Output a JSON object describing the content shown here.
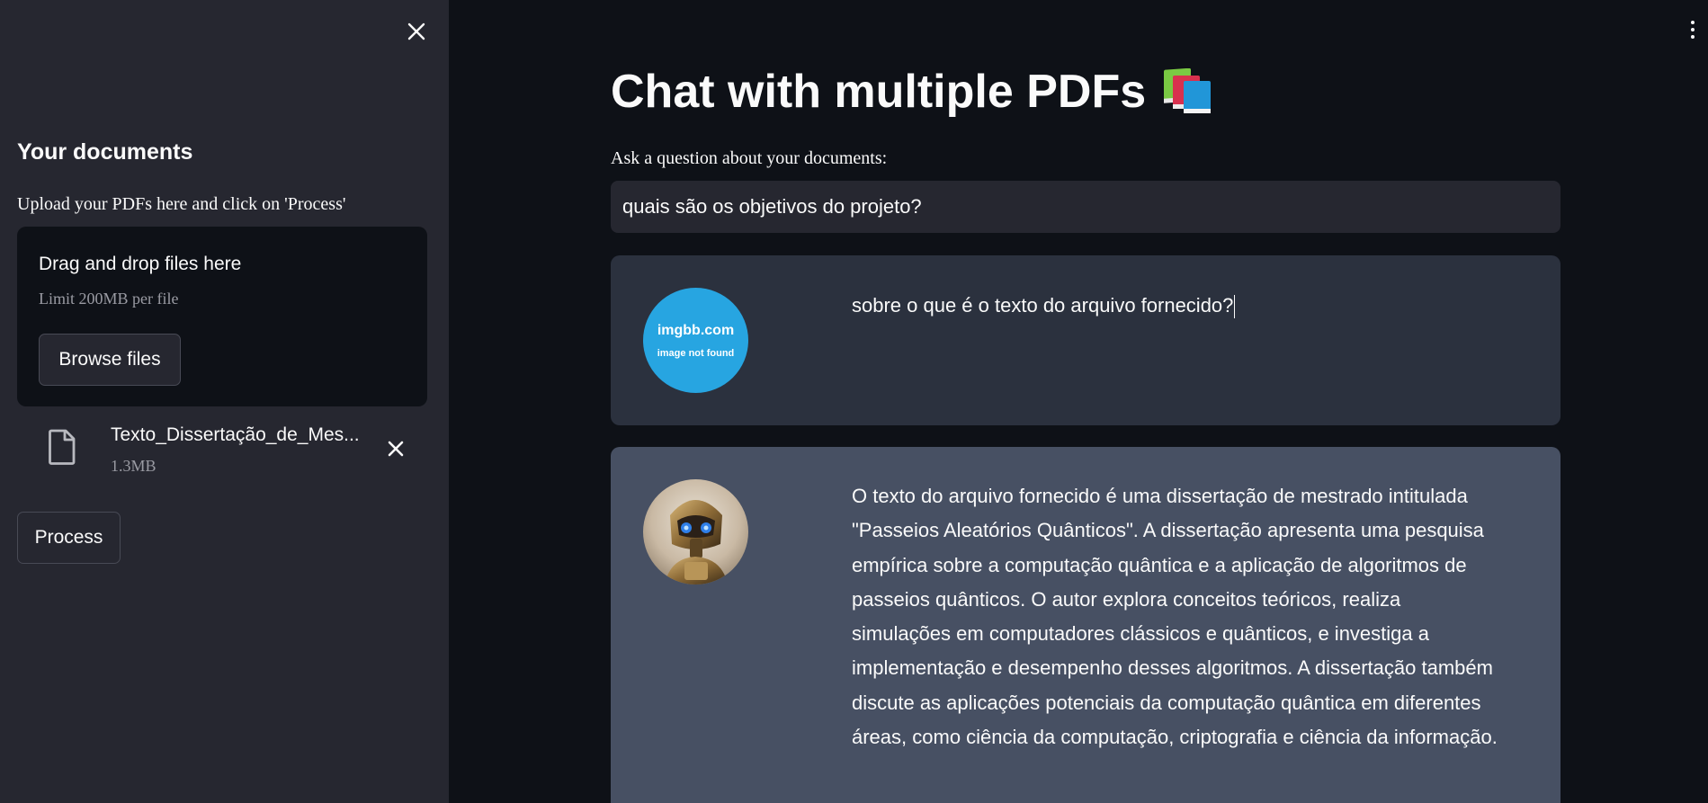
{
  "sidebar": {
    "title": "Your documents",
    "upload_label": "Upload your PDFs here and click on 'Process'",
    "dropzone": {
      "title": "Drag and drop files here",
      "limit": "Limit 200MB per file",
      "browse_label": "Browse files"
    },
    "files": [
      {
        "name": "Texto_Dissertação_de_Mes...",
        "size": "1.3MB"
      }
    ],
    "process_label": "Process"
  },
  "main": {
    "title": "Chat with multiple PDFs",
    "title_emoji": "books-icon",
    "question_label": "Ask a question about your documents:",
    "question_value": "quais são os objetivos do projeto?",
    "messages": [
      {
        "role": "user",
        "avatar_line1": "imgbb.com",
        "avatar_line2": "image not found",
        "text": "sobre o que é o texto do arquivo fornecido?"
      },
      {
        "role": "bot",
        "avatar": "robot-avatar",
        "text": "O texto do arquivo fornecido é uma dissertação de mestrado intitulada \"Passeios Aleatórios Quânticos\". A dissertação apresenta uma pesquisa empírica sobre a computação quântica e a aplicação de algoritmos de passeios quânticos. O autor explora conceitos teóricos, realiza simulações em computadores clássicos e quânticos, e investiga a implementação e desempenho desses algoritmos. A dissertação também discute as aplicações potenciais da computação quântica em diferentes áreas, como ciência da computação, criptografia e ciência da informação."
      }
    ]
  },
  "colors": {
    "background": "#0e1117",
    "sidebar": "#262730",
    "user_msg": "#2b313e",
    "bot_msg": "#475063",
    "user_avatar": "#27a5e1"
  }
}
